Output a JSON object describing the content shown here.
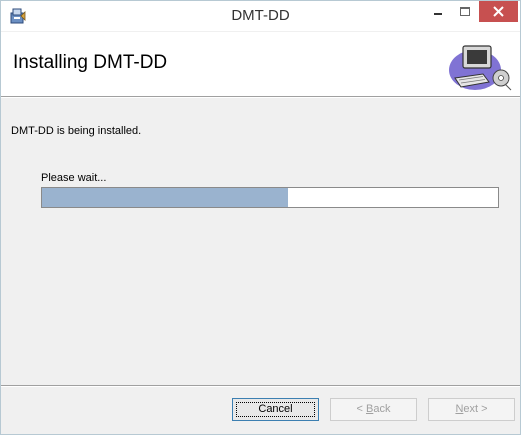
{
  "window": {
    "title": "DMT-DD",
    "icon": "installer-icon",
    "controls": {
      "minimize": "minimize-icon",
      "maximize": "maximize-icon",
      "close": "close-icon"
    },
    "close_color": "#c75050"
  },
  "header": {
    "title": "Installing DMT-DD",
    "graphic": "computer-setup-graphic"
  },
  "body": {
    "status": "DMT-DD is being installed.",
    "wait_label": "Please wait...",
    "progress_fraction": 0.54,
    "progress_color": "#9ab3cf"
  },
  "buttons": {
    "cancel": "Cancel",
    "back": {
      "prefix": "< ",
      "accel": "B",
      "rest": "ack"
    },
    "next": {
      "accel": "N",
      "rest": "ext >"
    }
  }
}
